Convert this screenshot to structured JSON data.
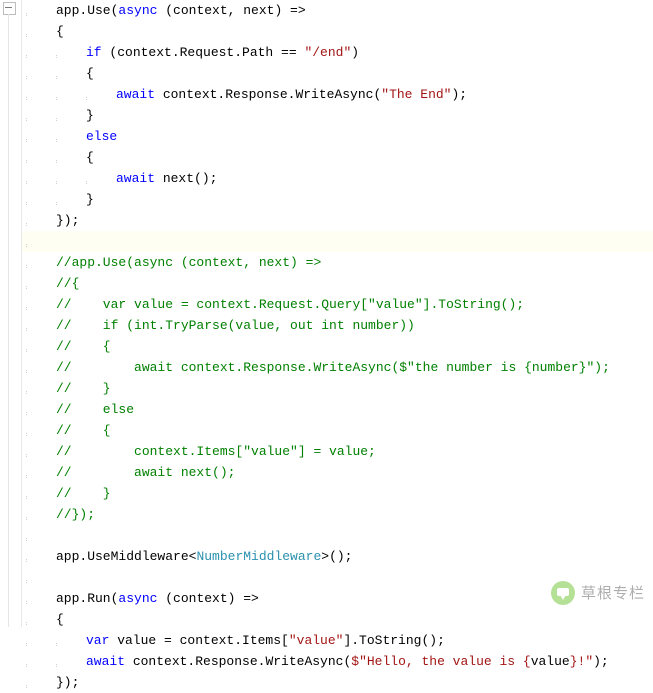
{
  "code": {
    "lines": [
      [
        [
          "",
          "app.Use("
        ],
        [
          "kw",
          "async"
        ],
        [
          "",
          " (context, next) =>"
        ]
      ],
      [
        [
          "",
          "{"
        ]
      ],
      [
        [
          "",
          "    "
        ],
        [
          "kw",
          "if"
        ],
        [
          "",
          " (context.Request.Path == "
        ],
        [
          "str",
          "\"/end\""
        ],
        [
          "",
          ")"
        ]
      ],
      [
        [
          "",
          "    {"
        ]
      ],
      [
        [
          "",
          "        "
        ],
        [
          "kw",
          "await"
        ],
        [
          "",
          " context.Response.WriteAsync("
        ],
        [
          "str",
          "\"The End\""
        ],
        [
          "",
          ");"
        ]
      ],
      [
        [
          "",
          "    }"
        ]
      ],
      [
        [
          "",
          "    "
        ],
        [
          "kw",
          "else"
        ]
      ],
      [
        [
          "",
          "    {"
        ]
      ],
      [
        [
          "",
          "        "
        ],
        [
          "kw",
          "await"
        ],
        [
          "",
          " next();"
        ]
      ],
      [
        [
          "",
          "    }"
        ]
      ],
      [
        [
          "",
          "});"
        ]
      ],
      [
        [
          "",
          ""
        ]
      ],
      [
        [
          "com",
          "//app.Use(async (context, next) =>"
        ]
      ],
      [
        [
          "com",
          "//{"
        ]
      ],
      [
        [
          "com",
          "//    var value = context.Request.Query[\"value\"].ToString();"
        ]
      ],
      [
        [
          "com",
          "//    if (int.TryParse(value, out int number))"
        ]
      ],
      [
        [
          "com",
          "//    {"
        ]
      ],
      [
        [
          "com",
          "//        await context.Response.WriteAsync($\"the number is {number}\");"
        ]
      ],
      [
        [
          "com",
          "//    }"
        ]
      ],
      [
        [
          "com",
          "//    else"
        ]
      ],
      [
        [
          "com",
          "//    {"
        ]
      ],
      [
        [
          "com",
          "//        context.Items[\"value\"] = value;"
        ]
      ],
      [
        [
          "com",
          "//        await next();"
        ]
      ],
      [
        [
          "com",
          "//    }"
        ]
      ],
      [
        [
          "com",
          "//});"
        ]
      ],
      [
        [
          "",
          ""
        ]
      ],
      [
        [
          "",
          "app.UseMiddleware<"
        ],
        [
          "type",
          "NumberMiddleware"
        ],
        [
          "",
          ">();"
        ]
      ],
      [
        [
          "",
          ""
        ]
      ],
      [
        [
          "",
          "app.Run("
        ],
        [
          "kw",
          "async"
        ],
        [
          "",
          " (context) =>"
        ]
      ],
      [
        [
          "",
          "{"
        ]
      ],
      [
        [
          "",
          "    "
        ],
        [
          "kw",
          "var"
        ],
        [
          "",
          " value = context.Items["
        ],
        [
          "str",
          "\"value\""
        ],
        [
          "",
          "].ToString();"
        ]
      ],
      [
        [
          "",
          "    "
        ],
        [
          "kw",
          "await"
        ],
        [
          "",
          " context.Response.WriteAsync("
        ],
        [
          "istr",
          "$\"Hello, the value is {"
        ],
        [
          "",
          "value"
        ],
        [
          "istr",
          "}!\""
        ],
        [
          "",
          ");"
        ]
      ],
      [
        [
          "",
          "});"
        ]
      ]
    ],
    "highlight_line_index": 11
  },
  "watermark": {
    "text": "草根专栏"
  }
}
